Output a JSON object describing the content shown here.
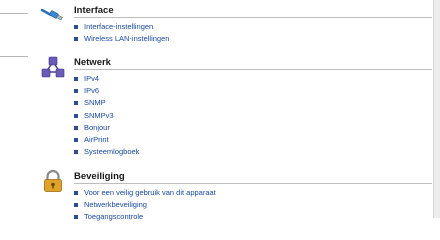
{
  "sections": [
    {
      "icon": "cable-icon",
      "title": "Interface",
      "links": [
        "Interface-instellingen",
        "Wireless LAN-instellingen"
      ]
    },
    {
      "icon": "network-icon",
      "title": "Netwerk",
      "links": [
        "IPv4",
        "IPv6",
        "SNMP",
        "SNMPv3",
        "Bonjour",
        "AirPrint",
        "Systeemlogboek"
      ]
    },
    {
      "icon": "padlock-icon",
      "title": "Beveiliging",
      "links": [
        "Voor een veilig gebruik van dit apparaat",
        "Netwerkbeveiliging",
        "Toegangscontrole"
      ]
    }
  ],
  "colors": {
    "link": "#1a4aa0",
    "bullet": "#2a4f92",
    "title": "#1a1a1a",
    "rule": "#bdbdbd"
  }
}
